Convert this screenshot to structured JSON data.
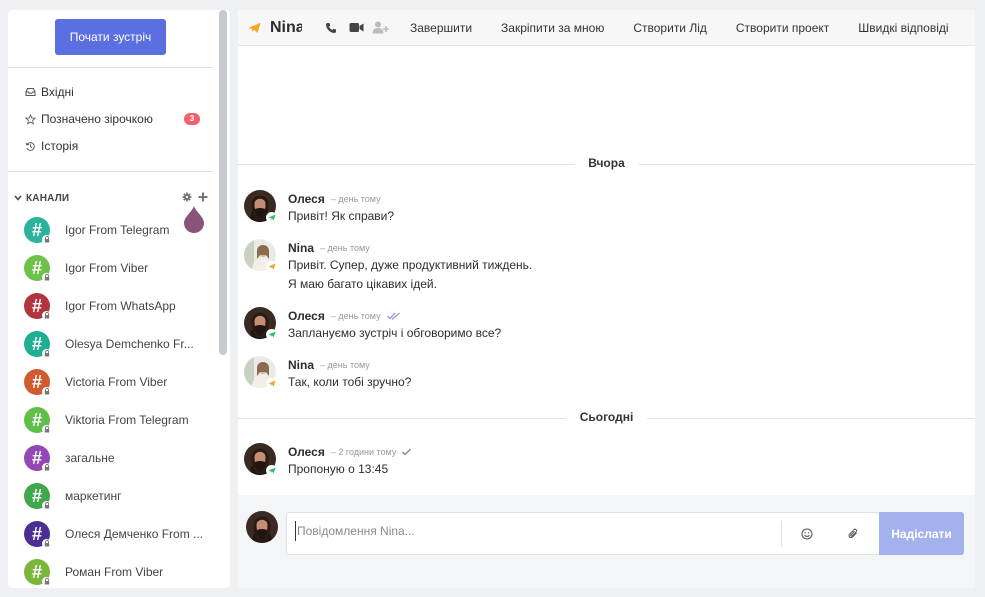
{
  "sidebar": {
    "start_meeting_label": "Почати зустріч",
    "nav": [
      {
        "label": "Вхідні",
        "icon": "inbox-icon"
      },
      {
        "label": "Позначено зірочкою",
        "icon": "star-icon",
        "badge": "3"
      },
      {
        "label": "Історія",
        "icon": "history-icon"
      }
    ],
    "channels_label": "КАНАЛИ",
    "channels": [
      {
        "name": "Igor From Telegram",
        "color": "#2bb39b"
      },
      {
        "name": "Igor From Viber",
        "color": "#6ec14b"
      },
      {
        "name": "Igor From WhatsApp",
        "color": "#b2343e"
      },
      {
        "name": "Olesya Demchenko Fr...",
        "color": "#1fae93"
      },
      {
        "name": "Victoria From Viber",
        "color": "#d15b30"
      },
      {
        "name": "Viktoria From Telegram",
        "color": "#5fbf4a"
      },
      {
        "name": "загальне",
        "color": "#9348b6"
      },
      {
        "name": "маркетинг",
        "color": "#3fa84c"
      },
      {
        "name": "Олеся Демченко From ...",
        "color": "#4a2e93"
      },
      {
        "name": "Роман From Viber",
        "color": "#7bb63b"
      }
    ]
  },
  "header": {
    "title": "Nina",
    "menu": [
      "Завершити",
      "Закріпити за мною",
      "Створити Лід",
      "Створити проект",
      "Швидкі відповіді"
    ]
  },
  "messages": {
    "yesterday_label": "Вчора",
    "today_label": "Сьогодні",
    "items": [
      {
        "author": "Олеся",
        "time": "день тому",
        "lines": [
          "Привіт! Як справи?"
        ]
      },
      {
        "author": "Nina",
        "time": "день тому",
        "lines": [
          "Привіт. Супер, дуже продуктивний тиждень.",
          "Я маю багато цікавих ідей."
        ]
      },
      {
        "author": "Олеся",
        "time": "день тому",
        "lines": [
          "Заплануємо зустріч і обговоримо все?"
        ]
      },
      {
        "author": "Nina",
        "time": "день тому",
        "lines": [
          "Так, коли тобі зручно?"
        ]
      },
      {
        "author": "Олеся",
        "time": "2 години тому",
        "lines": [
          "Пропоную о 13:45"
        ]
      }
    ]
  },
  "composer": {
    "placeholder": "Повідомлення Nina...",
    "send_label": "Надіслати"
  },
  "colors": {
    "accent": "#5b6fe0",
    "send_button": "#a3b2ec",
    "badge": "#f2616d",
    "plane_orange": "#f5a623",
    "plane_green": "#2fbf71"
  }
}
